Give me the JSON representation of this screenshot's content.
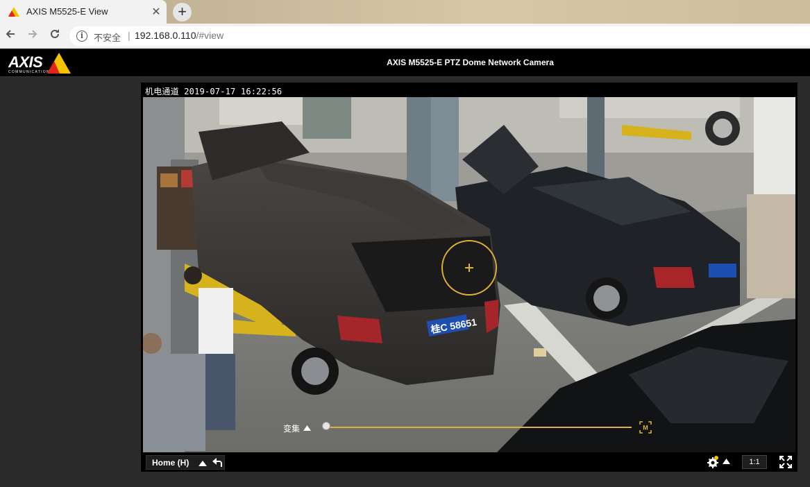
{
  "browser": {
    "tab_title": "AXIS M5525-E View",
    "tab_close": "✕",
    "new_tab": "+",
    "security_label": "不安全",
    "url_host": "192.168.0.110",
    "url_path": "/#view"
  },
  "header": {
    "brand": "AXIS",
    "brand_sub": "COMMUNICATIONS",
    "camera_title": "AXIS M5525-E PTZ Dome Network Camera"
  },
  "video": {
    "overlay_text": "机电通道 2019-07-17 16:22:56",
    "plate_left": "桂C 58651",
    "zoom_label": "变集",
    "zoom_level": 0.0
  },
  "controls": {
    "preset_label": "Home (H)",
    "ratio_label": "1:1"
  },
  "colors": {
    "accent": "#e0b03a",
    "header_bg": "#000000",
    "page_bg": "#2a2a2a"
  }
}
